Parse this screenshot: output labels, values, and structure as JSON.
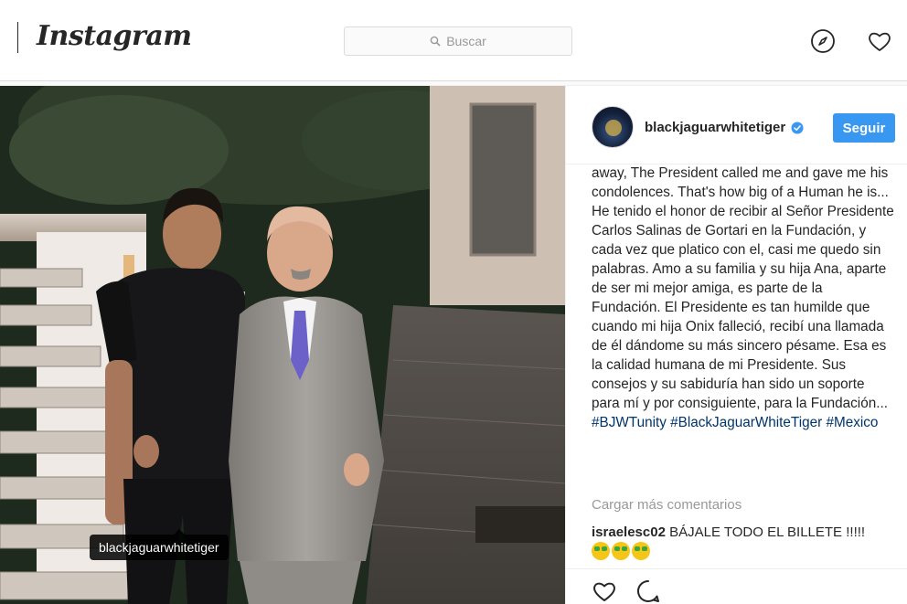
{
  "header": {
    "logo": "Instagram",
    "search_placeholder": "Buscar",
    "icons": [
      "explore-compass-icon",
      "activity-heart-icon"
    ]
  },
  "post": {
    "photo_tag": "blackjaguarwhitetiger",
    "author": "blackjaguarwhitetiger",
    "verified": true,
    "follow_label": "Seguir",
    "caption": {
      "text": "away, The President called me and gave me his condolences. That's how big of a Human he is... He tenido el honor de recibir al Señor Presidente Carlos Salinas de Gortari en la Fundación, y cada vez que platico con el, casi me quedo sin palabras. Amo a su familia y su hija Ana, aparte de ser mi mejor amiga, es parte de la Fundación. El Presidente es tan humilde que cuando mi hija Onix falleció, recibí una llamada de él dándome su más sincero pésame. Esa es la calidad humana de mi Presidente. Sus consejos y su sabiduría han sido un soporte para mí y por consiguiente, para la Fundación...",
      "hashtags": [
        "#BJWTunity",
        "#BlackJaguarWhiteTiger",
        "#Mexico"
      ]
    },
    "load_more_label": "Cargar más comentarios",
    "comments": [
      {
        "user": "israelesc02",
        "text": "BÁJALE TODO EL BILLETE !!!!!",
        "emoji": "money-mouth-face x3"
      }
    ],
    "action_icons": [
      "like-heart-icon",
      "comment-bubble-icon"
    ]
  },
  "colors": {
    "accent": "#3897f0",
    "hashtag": "#003569",
    "muted": "#999999",
    "border": "#dbdbdb"
  }
}
